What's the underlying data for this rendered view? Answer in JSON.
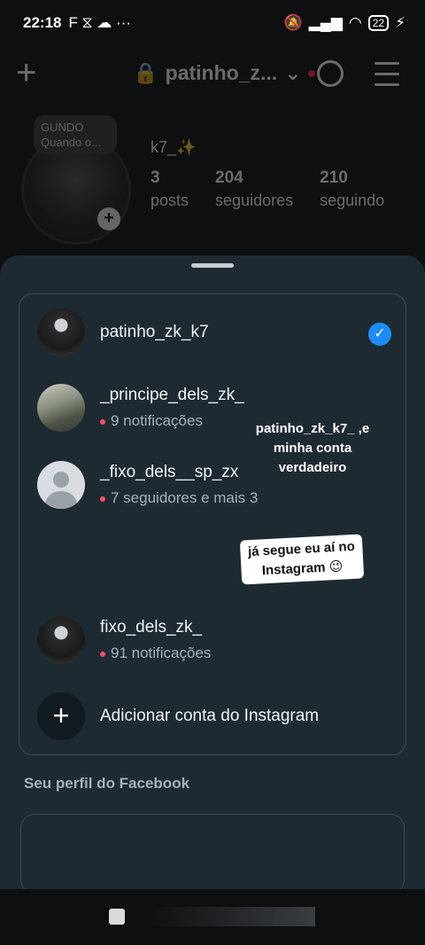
{
  "status_bar": {
    "time": "22:18",
    "left_icons": "F ⧖ ☁ ···",
    "battery": "22"
  },
  "profile_header": {
    "username": "patinho_z...",
    "note_label": "GUNDO",
    "note_text": "Quando o...",
    "display_name": "k7_✨",
    "stats": [
      {
        "value": "3",
        "label": "posts"
      },
      {
        "value": "204",
        "label": "seguidores"
      },
      {
        "value": "210",
        "label": "seguindo"
      }
    ]
  },
  "accounts": [
    {
      "name": "patinho_zk_k7",
      "subtitle": "",
      "selected": true
    },
    {
      "name": "_principe_dels_zk_",
      "subtitle": "9 notificações",
      "selected": false
    },
    {
      "name": "_fixo_dels__sp_zx",
      "subtitle": "7 seguidores e mais 3",
      "selected": false
    },
    {
      "name": "fixo_dels_zk_",
      "subtitle": "91 notificações",
      "selected": false
    }
  ],
  "add_account_label": "Adicionar conta do Instagram",
  "stickers": {
    "sticker1": "patinho_zk_k7_ ,e minha conta verdadeiro",
    "sticker2": "já segue eu aí no Instagram 😉"
  },
  "facebook_section_label": "Seu perfil do Facebook",
  "colors": {
    "sheet_bg": "#1e2a32",
    "accent_blue": "#1d8cf8",
    "notification_dot": "#ff4d6d"
  }
}
